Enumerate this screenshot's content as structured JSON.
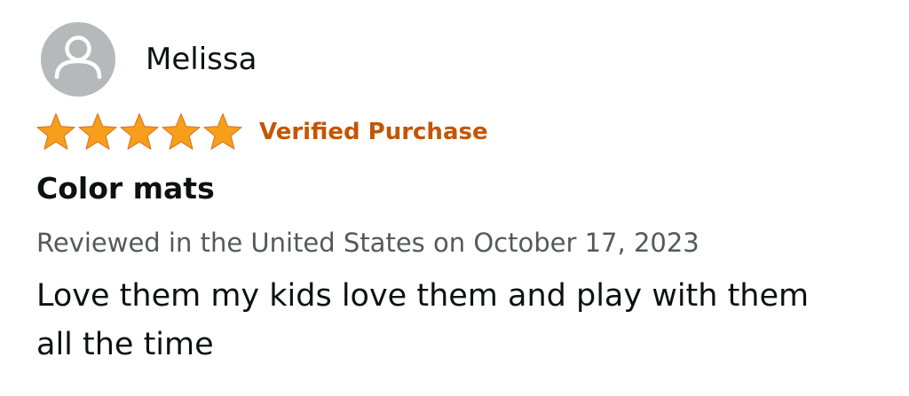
{
  "review": {
    "profile": {
      "name": "Melissa",
      "avatar_icon": "default-user-avatar-icon"
    },
    "rating": {
      "stars": 5,
      "max_stars": 5,
      "star_color": "#f79e1b",
      "star_icon": "star-icon"
    },
    "verified_label": "Verified Purchase",
    "verified_color": "#c45500",
    "title": "Color mats",
    "meta": "Reviewed in the United States on October 17, 2023",
    "body": "Love them my kids love them and play with them all the time"
  }
}
